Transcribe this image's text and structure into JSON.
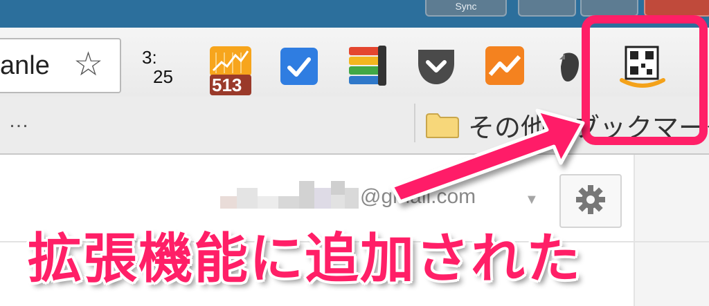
{
  "window": {
    "title_button": "Sync"
  },
  "toolbar": {
    "omnibox_text": "anle",
    "clock_line1": "3:",
    "clock_line2": "25",
    "extension_badge": "513",
    "extensions": [
      "stock-chart-extension-icon",
      "check-extension-icon",
      "stacked-bars-extension-icon",
      "pocket-extension-icon",
      "analytics-extension-icon",
      "evernote-extension-icon",
      "amazon-qr-extension-icon"
    ]
  },
  "bookmarks": {
    "overflow": "…",
    "other_bookmarks_label": "その他のブックマーク"
  },
  "page": {
    "account_email_suffix": "@gmail.com"
  },
  "annotation": {
    "caption": "拡張機能に追加された",
    "color": "#ff1f67"
  }
}
